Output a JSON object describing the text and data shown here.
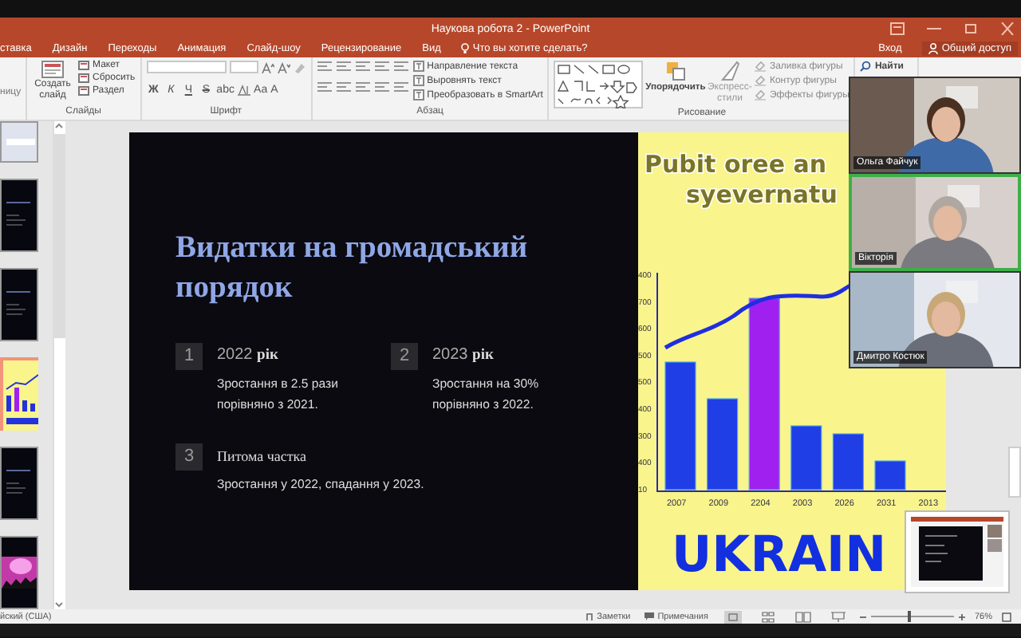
{
  "window": {
    "title": "Наукова робота 2 - PowerPoint"
  },
  "ribbon_tabs": [
    "ставка",
    "Дизайн",
    "Переходы",
    "Анимация",
    "Слайд-шоу",
    "Рецензирование",
    "Вид"
  ],
  "tell_me": "Что вы хотите сделать?",
  "sign_in": "Вход",
  "share": "Общий доступ",
  "ribbon": {
    "cut_left": "ницу",
    "groups": [
      {
        "kind": "slides",
        "label": "Слайды",
        "buttons": [
          "Создать слайд"
        ],
        "items": [
          "Макет",
          "Сбросить",
          "Раздел"
        ]
      },
      {
        "kind": "font",
        "label": "Шрифт",
        "format_buttons": [
          "Ж",
          "К",
          "Ч",
          "S",
          "abc",
          "Аа",
          "А"
        ]
      },
      {
        "kind": "paragraph",
        "label": "Абзац",
        "items": [
          "Направление текста",
          "Выровнять текст",
          "Преобразовать в SmartArt"
        ]
      },
      {
        "kind": "drawing",
        "label": "Рисование",
        "buttons": [
          "Упорядочить",
          "Экспресс-стили"
        ],
        "items": [
          "Заливка фигуры",
          "Контур фигуры",
          "Эффекты фигуры"
        ]
      },
      {
        "kind": "editing",
        "items": [
          "Найти"
        ]
      }
    ]
  },
  "slides": [
    {
      "kind": "light",
      "selected": false
    },
    {
      "kind": "dark",
      "selected": false
    },
    {
      "kind": "dark",
      "selected": false
    },
    {
      "kind": "chart",
      "selected": true
    },
    {
      "kind": "dark",
      "selected": false
    },
    {
      "kind": "concert",
      "selected": false
    }
  ],
  "slide": {
    "title": "Видатки на громадський порядок",
    "points": [
      {
        "kind": "year",
        "number": "1",
        "year": "2022",
        "suffix": "рік",
        "text": "Зростання в 2.5 рази порівняно з 2021."
      },
      {
        "kind": "year",
        "number": "2",
        "year": "2023",
        "suffix": "рік",
        "text": "Зростання на 30% порівняно з 2022."
      },
      {
        "kind": "heading",
        "number": "3",
        "heading": "Питома частка",
        "text": "Зростання у 2022, спадання у 2023."
      }
    ],
    "image_panel": {
      "heading": [
        "Pubit oree an",
        "syevernatu"
      ],
      "y_labels": [
        "400",
        "700",
        "600",
        "500",
        "500",
        "400",
        "300",
        "400",
        "10"
      ],
      "x_labels": [
        "2007",
        "2009",
        "2204",
        "2003",
        "2026",
        "2031",
        "2013"
      ],
      "banner": "UKRAIN"
    }
  },
  "participants": [
    {
      "name": "Ольга Файчук",
      "speaking": false
    },
    {
      "name": "Вікторія",
      "speaking": true
    },
    {
      "name": "Дмитро Костюк",
      "speaking": false
    }
  ],
  "status_bar": {
    "language": "йский (США)",
    "notes": "Заметки",
    "comments": "Примечания",
    "zoom": "76%",
    "zoom_slider": {
      "level": 0.45
    }
  }
}
